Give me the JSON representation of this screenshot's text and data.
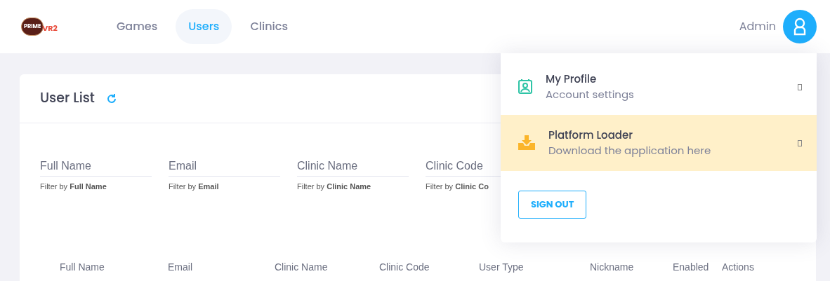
{
  "logo": {
    "badge": "PRIME",
    "mark": "VR2"
  },
  "nav": [
    {
      "label": "Games",
      "selected": false
    },
    {
      "label": "Users",
      "selected": true
    },
    {
      "label": "Clinics",
      "selected": false
    }
  ],
  "user": {
    "name": "Admin"
  },
  "card": {
    "title": "User List"
  },
  "filters": [
    {
      "placeholder": "Full Name",
      "hint": "Filter by **Full Name**"
    },
    {
      "placeholder": "Email",
      "hint": "Filter by **Email**"
    },
    {
      "placeholder": "Clinic Name",
      "hint": "Filter by **Clinic Name**"
    },
    {
      "placeholder": "Clinic Code",
      "hint": "Filter by **Clinic Co**"
    }
  ],
  "table": {
    "columns": [
      "Full Name",
      "Email",
      "Clinic Name",
      "Clinic Code",
      "User Type",
      "Nickname",
      "Enabled",
      "Actions"
    ]
  },
  "menu": {
    "items": [
      {
        "kind": "profile",
        "title": "My Profile",
        "subtitle": "Account settings",
        "selected": false
      },
      {
        "kind": "download",
        "title": "Platform Loader",
        "subtitle": "Download the application here",
        "selected": true
      }
    ],
    "sign_out": "SIGN OUT"
  }
}
